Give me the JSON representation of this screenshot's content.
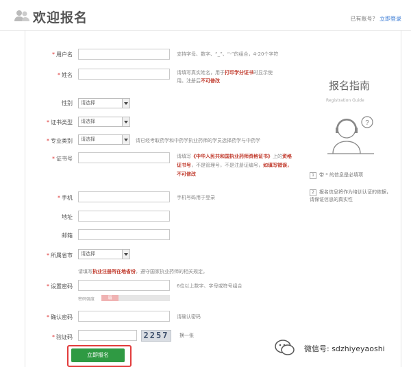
{
  "header": {
    "title": "欢迎报名",
    "account_prompt": "已有账号？",
    "login_link": "立即登录"
  },
  "form": {
    "username": {
      "label": "用户名",
      "required": true,
      "hint": "支持字母、数字、“_”、“-”的组合，4-20个字符"
    },
    "name": {
      "label": "姓名",
      "required": true,
      "hint_pre": "请填写真实姓名，用于",
      "hint_red": "打印学分证书",
      "hint_post": "时显示使用。注册后",
      "hint_red2": "不可修改"
    },
    "gender": {
      "label": "性别",
      "required": false,
      "selected": "请选择"
    },
    "cert_type": {
      "label": "证书类型",
      "required": true,
      "selected": "请选择"
    },
    "major": {
      "label": "专业类别",
      "required": true,
      "selected": "请选择",
      "hint": "请已经考取药学和中药学执业药师的学员选择药学与中药学"
    },
    "cert_no": {
      "label": "证书号",
      "required": true,
      "hint_pre": "请填写",
      "hint_red": "《中华人民共和国执业药师资格证书》",
      "hint_mid": "上的",
      "hint_red2": "资格证书号",
      "hint_mid2": "，不是管理号，不是注册证编号，",
      "hint_red3": "如填写错误，不可修改"
    },
    "phone": {
      "label": "手机",
      "required": true,
      "hint": "手机号码用于登录"
    },
    "address": {
      "label": "地址",
      "required": false
    },
    "postcode": {
      "label": "邮箱",
      "required": false
    },
    "city": {
      "label": "所属省市",
      "required": true,
      "selected": "请选择",
      "hint_pre": "请填写",
      "hint_red": "执业注册所在地省份",
      "hint_post": "，遵守国家执业药师的相关规定。"
    },
    "password": {
      "label": "设置密码",
      "required": true,
      "hint": "6位以上数字、字母或符号组合",
      "strength_label": "密码强度",
      "strength_level": "弱",
      "strength_value": 0.25
    },
    "password_confirm": {
      "label": "确认密码",
      "required": true,
      "hint": "请确认密码"
    },
    "captcha": {
      "label": "验证码",
      "required": true,
      "code": "2257",
      "refresh": "换一张"
    },
    "submit": "立即报名"
  },
  "guide": {
    "title": "报名指南",
    "subtitle": "Registration Guide",
    "tips": [
      {
        "num": "1",
        "text": "带 * 的信息是必填项"
      },
      {
        "num": "2",
        "text": "报名信息将作为培训认证的依据，请保证信息的真实性"
      }
    ]
  },
  "watermark": "微信号: sdzhiyeyaoshi",
  "colors": {
    "accent_red": "#d33",
    "submit_green": "#2f9a43",
    "link_blue": "#3a7bd5"
  }
}
